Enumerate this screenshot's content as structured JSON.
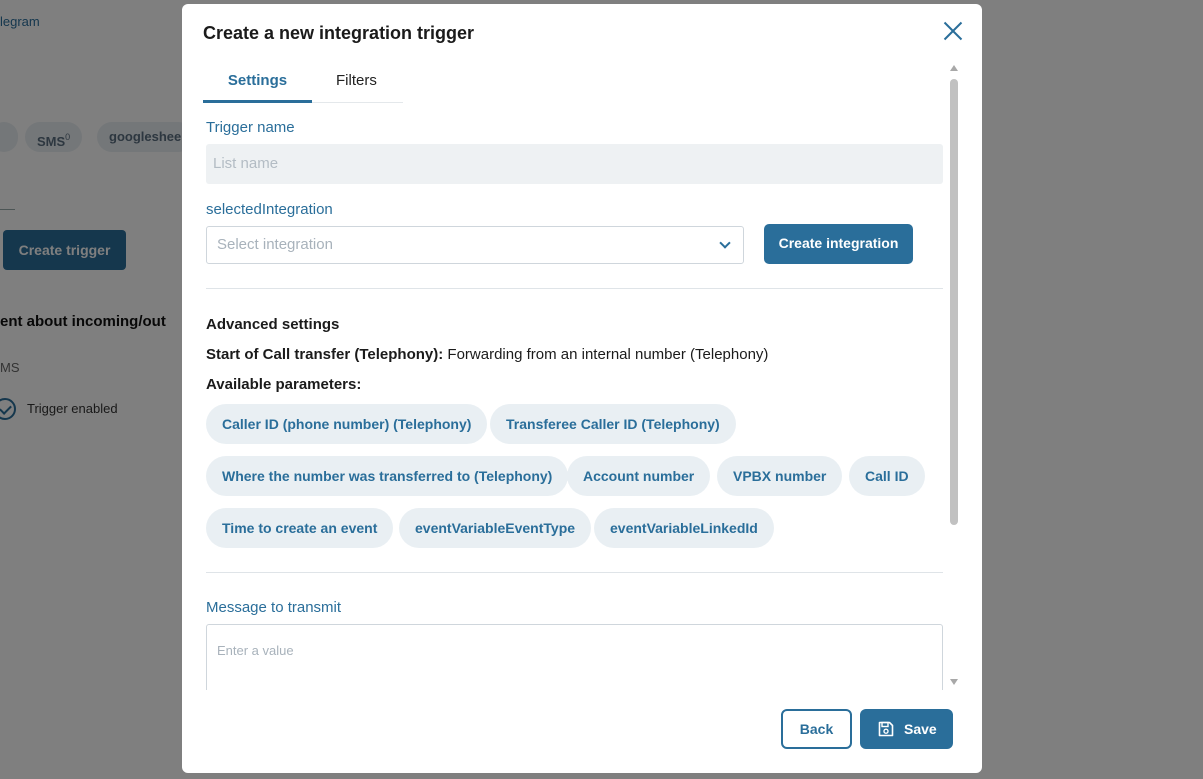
{
  "background": {
    "telegram_fragment": "legram",
    "chips": [
      {
        "label": "SMS",
        "count": "0"
      },
      {
        "label": "googleshee",
        "count": ""
      }
    ],
    "create_trigger_button": "Create trigger",
    "card_title": "ent about incoming/out",
    "card_channel": "MS",
    "trigger_enabled": "Trigger enabled"
  },
  "modal": {
    "title": "Create a new integration trigger",
    "tabs": [
      {
        "label": "Settings",
        "active": true
      },
      {
        "label": "Filters",
        "active": false
      }
    ],
    "trigger_name": {
      "label": "Trigger name",
      "placeholder": "List name"
    },
    "selected_integration": {
      "label": "selectedIntegration",
      "placeholder": "Select integration"
    },
    "create_integration_button": "Create integration",
    "advanced_settings": "Advanced settings",
    "event_line": {
      "bold": "Start of Call transfer (Telephony):",
      "text": " Forwarding from an internal number (Telephony)"
    },
    "available_parameters": "Available parameters:",
    "parameters": [
      "Caller ID (phone number) (Telephony)",
      "Transferee Caller ID (Telephony)",
      "Where the number was transferred to (Telephony)",
      "Account number",
      "VPBX number",
      "Call ID",
      "Time to create an event",
      "eventVariableEventType",
      "eventVariableLinkedId"
    ],
    "message": {
      "label": "Message to transmit",
      "placeholder": "Enter a value"
    },
    "back_button": "Back",
    "save_button": "Save"
  },
  "colors": {
    "accent": "#2a6e9a",
    "overlay": "rgba(0,0,0,0.5)"
  }
}
